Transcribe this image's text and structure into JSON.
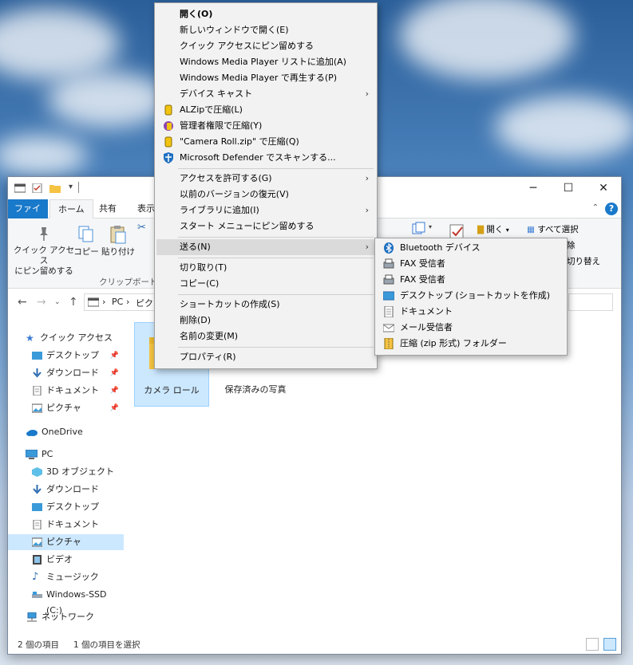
{
  "window": {
    "ribbon_tabs": [
      "ファイル",
      "ホーム",
      "共有",
      "表示"
    ],
    "help": "?",
    "ribbon": {
      "pin_label": "クイック アクセス\nにピン留めする",
      "copy": "コピー",
      "paste": "貼り付け",
      "clipboard_group": "クリップボード",
      "open": "開く",
      "select_all": "すべて選択",
      "partial_1": "除",
      "partial_2": "切り替え"
    },
    "address": {
      "pc": "PC",
      "partial": "ピク"
    },
    "nav": {
      "quick_access": "クイック アクセス",
      "quick_items": [
        "デスクトップ",
        "ダウンロード",
        "ドキュメント",
        "ピクチャ"
      ],
      "onedrive": "OneDrive",
      "pc": "PC",
      "pc_items": [
        "3D オブジェクト",
        "ダウンロード",
        "デスクトップ",
        "ドキュメント",
        "ピクチャ",
        "ビデオ",
        "ミュージック",
        "Windows-SSD (C:)"
      ],
      "network": "ネットワーク"
    },
    "folders": [
      "カメラ ロール",
      "保存済みの写真"
    ],
    "status": {
      "count": "2 個の項目",
      "selected": "1 個の項目を選択"
    }
  },
  "context_menu": {
    "items": [
      {
        "label": "開く(O)",
        "bold": true
      },
      {
        "label": "新しいウィンドウで開く(E)"
      },
      {
        "label": "クイック アクセスにピン留めする"
      },
      {
        "label": "Windows Media Player リストに追加(A)"
      },
      {
        "label": "Windows Media Player で再生する(P)"
      },
      {
        "label": "デバイス キャスト",
        "submenu": true
      },
      {
        "label": "ALZipで圧縮(L)",
        "icon": "alzip-icon"
      },
      {
        "label": "管理者権限で圧縮(Y)",
        "icon": "admin-zip-icon"
      },
      {
        "label": "\"Camera Roll.zip\" で圧縮(Q)",
        "icon": "alzip-icon"
      },
      {
        "label": "Microsoft Defender でスキャンする...",
        "icon": "defender-icon"
      },
      {
        "label": "アクセスを許可する(G)",
        "submenu": true
      },
      {
        "label": "以前のバージョンの復元(V)"
      },
      {
        "label": "ライブラリに追加(I)",
        "submenu": true
      },
      {
        "label": "スタート メニューにピン留めする"
      },
      {
        "label": "送る(N)",
        "submenu": true
      },
      {
        "label": "切り取り(T)"
      },
      {
        "label": "コピー(C)"
      },
      {
        "label": "ショートカットの作成(S)"
      },
      {
        "label": "削除(D)"
      },
      {
        "label": "名前の変更(M)"
      },
      {
        "label": "プロパティ(R)"
      }
    ]
  },
  "send_to_menu": {
    "items": [
      {
        "label": "Bluetooth デバイス",
        "icon": "bluetooth-icon"
      },
      {
        "label": "FAX 受信者",
        "icon": "fax-icon"
      },
      {
        "label": "FAX 受信者",
        "icon": "fax-icon"
      },
      {
        "label": "デスクトップ (ショートカットを作成)",
        "icon": "desktop-icon"
      },
      {
        "label": "ドキュメント",
        "icon": "document-icon"
      },
      {
        "label": "メール受信者",
        "icon": "mail-icon"
      },
      {
        "label": "圧縮 (zip 形式) フォルダー",
        "icon": "zip-folder-icon"
      }
    ]
  },
  "colors": {
    "accent": "#1979ca",
    "selection": "#cce8ff",
    "menu_bg": "#f2f2f2",
    "folder": "#f5c342"
  }
}
